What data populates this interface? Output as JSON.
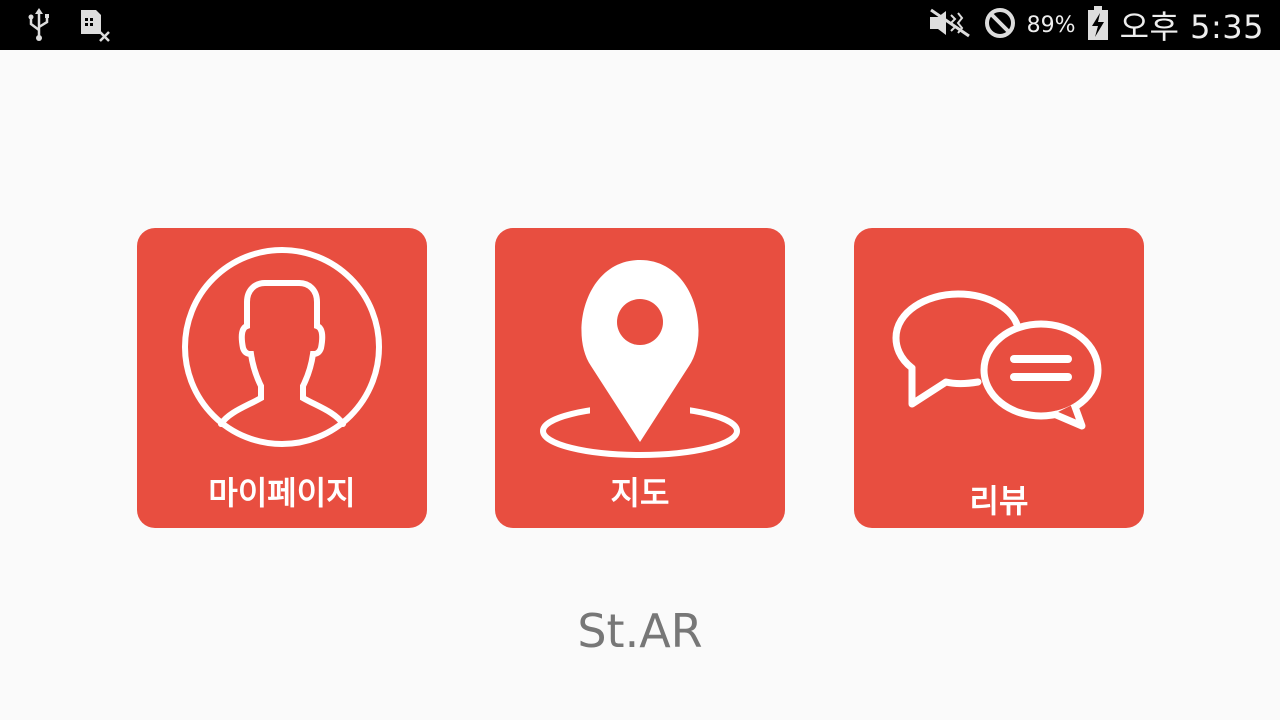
{
  "status_bar": {
    "left_icons": [
      "usb-icon",
      "sim-card-missing-icon"
    ],
    "right_icons": [
      "vibrate-mute-icon",
      "do-not-disturb-icon",
      "battery-charging-icon"
    ],
    "battery": "89%",
    "time": "오후 5:35"
  },
  "menu": {
    "tiles": [
      {
        "label": "마이페이지",
        "icon": "user-profile-icon"
      },
      {
        "label": "지도",
        "icon": "map-pin-icon"
      },
      {
        "label": "리뷰",
        "icon": "chat-bubbles-icon"
      }
    ]
  },
  "app_name": "St.AR",
  "colors": {
    "accent": "#e84e40",
    "background": "#fafafa",
    "statusbar": "#000000",
    "app_name_text": "#777777"
  }
}
